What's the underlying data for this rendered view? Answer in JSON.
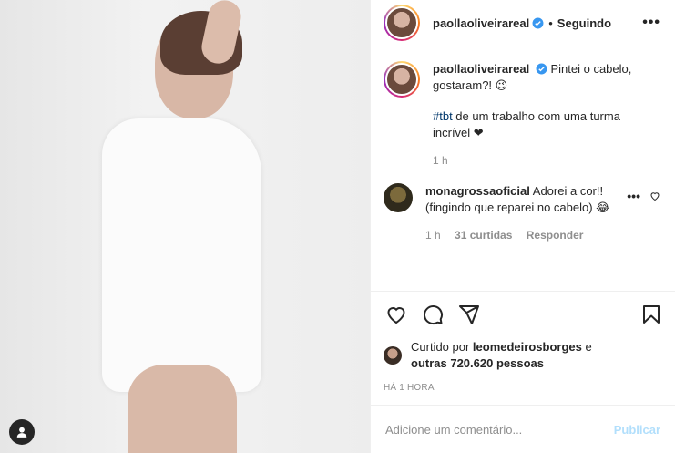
{
  "post": {
    "author": "paollaoliveirareal",
    "verified": true,
    "follow_state": "Seguindo",
    "more_icon": "more-horizontal-icon",
    "caption_line1": "Pintei o cabelo, gostaram?! 😉",
    "caption_hashtag": "#tbt",
    "caption_rest": " de um trabalho com uma turma incrível ❤",
    "caption_time": "1 h"
  },
  "comment": {
    "author": "monagrossaoficial",
    "text": "Adorei a cor!! (fingindo que reparei no cabelo) 😂",
    "time": "1 h",
    "likes": "31 curtidas",
    "reply": "Responder"
  },
  "actions": {
    "like": "heart-icon",
    "comment": "comment-icon",
    "share": "share-icon",
    "save": "bookmark-icon"
  },
  "likes": {
    "prefix": "Curtido por ",
    "user": "leomedeirosborges",
    "middle": " e ",
    "others": "outras 720.620 pessoas"
  },
  "timestamp": "HÁ 1 HORA",
  "add_comment": {
    "placeholder": "Adicione um comentário...",
    "publish": "Publicar"
  },
  "colors": {
    "accent": "#0095f6",
    "publish_disabled": "#b2dffc",
    "verified": "#3897f0"
  }
}
